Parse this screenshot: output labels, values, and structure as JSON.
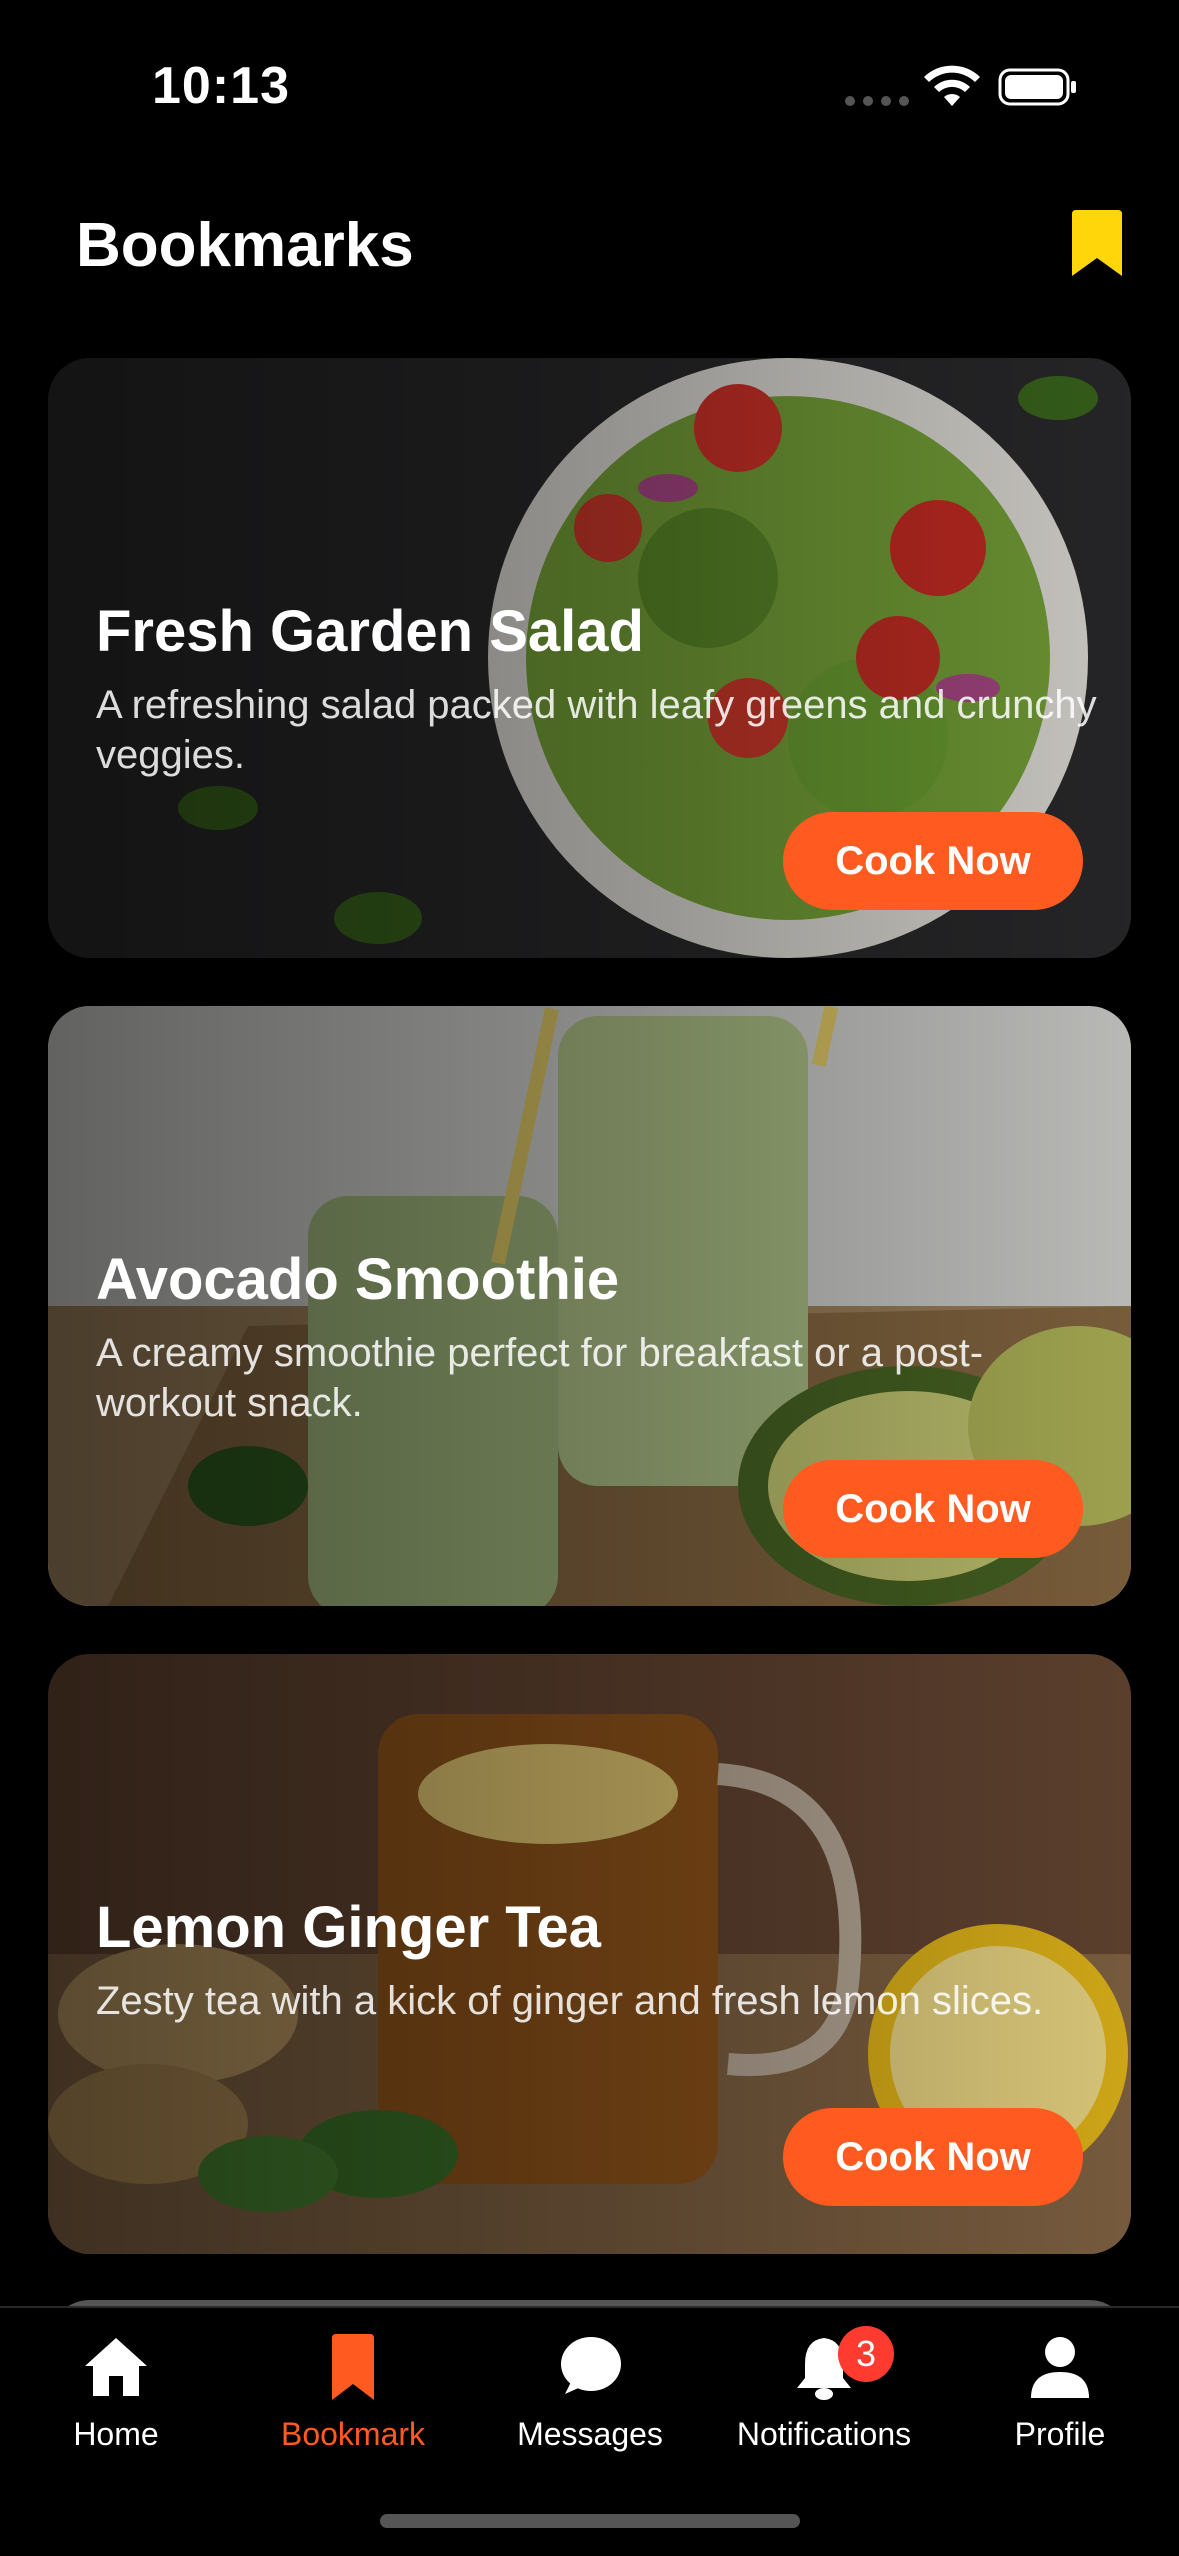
{
  "status_bar": {
    "time": "10:13"
  },
  "header": {
    "title": "Bookmarks",
    "bookmark_icon_color": "#FFD60A"
  },
  "cards": [
    {
      "title": "Fresh Garden Salad",
      "description": "A refreshing salad packed with leafy greens and crunchy veggies.",
      "button_label": "Cook Now"
    },
    {
      "title": "Avocado Smoothie",
      "description": "A creamy smoothie perfect for breakfast or a post-workout snack.",
      "button_label": "Cook Now"
    },
    {
      "title": "Lemon Ginger Tea",
      "description": "Zesty tea with a kick of ginger and fresh lemon slices.",
      "button_label": "Cook Now"
    }
  ],
  "tabs": [
    {
      "label": "Home",
      "icon": "home-icon"
    },
    {
      "label": "Bookmark",
      "icon": "bookmark-icon",
      "active": true
    },
    {
      "label": "Messages",
      "icon": "chat-bubble-icon"
    },
    {
      "label": "Notifications",
      "icon": "bell-icon",
      "badge": "3"
    },
    {
      "label": "Profile",
      "icon": "person-icon"
    }
  ],
  "colors": {
    "accent": "#FF5A1F",
    "badge": "#FF3B30",
    "background": "#000000"
  }
}
